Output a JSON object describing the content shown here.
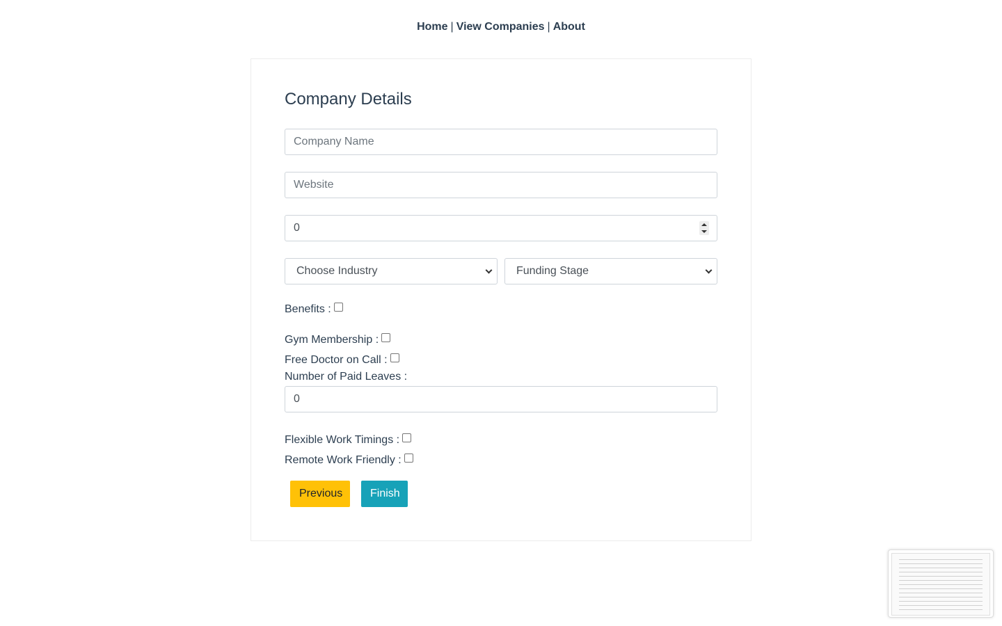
{
  "nav": {
    "items": [
      "Home",
      "View Companies",
      "About"
    ],
    "separator": "|"
  },
  "form": {
    "title": "Company Details",
    "company_name": {
      "placeholder": "Company Name",
      "value": ""
    },
    "website": {
      "placeholder": "Website",
      "value": ""
    },
    "employees": {
      "value": "0"
    },
    "industry": {
      "selected": "Choose Industry"
    },
    "funding_stage": {
      "selected": "Funding Stage"
    },
    "benefits_label": "Benefits :",
    "gym_label": "Gym Membership :",
    "doctor_label": "Free Doctor on Call :",
    "paid_leaves_label": "Number of Paid Leaves :",
    "paid_leaves": {
      "value": "0"
    },
    "flexible_label": "Flexible Work Timings :",
    "remote_label": "Remote Work Friendly :",
    "checkboxes": {
      "benefits": false,
      "gym": false,
      "doctor": false,
      "flexible": false,
      "remote": false
    }
  },
  "buttons": {
    "previous": "Previous",
    "finish": "Finish"
  },
  "colors": {
    "text": "#2c3e50",
    "previous_bg": "#ffc107",
    "finish_bg": "#17a2b8"
  }
}
